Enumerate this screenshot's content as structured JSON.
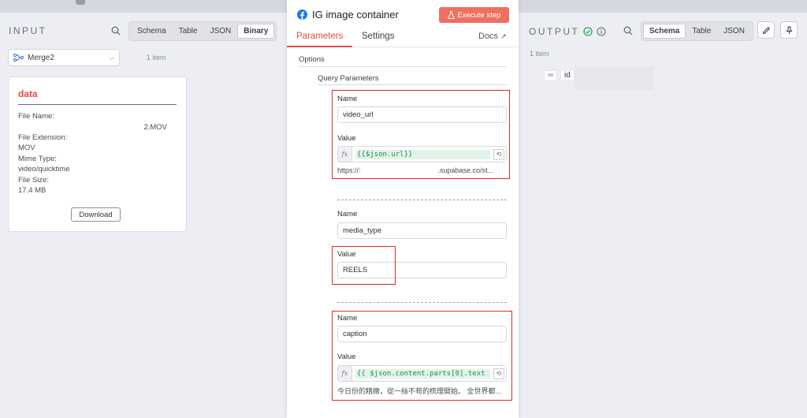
{
  "input": {
    "title": "INPUT",
    "tabs": [
      "Schema",
      "Table",
      "JSON",
      "Binary"
    ],
    "active_tab": "Binary",
    "node": "Merge2",
    "item_count": "1 item",
    "card": {
      "title": "data",
      "file_name_label": "File Name:",
      "file_name": "2.MOV",
      "file_ext_label": "File Extension:",
      "file_ext": "MOV",
      "mime_label": "Mime Type:",
      "mime": "video/quicktime",
      "size_label": "File Size:",
      "size": "17.4 MB",
      "download": "Download"
    }
  },
  "node_panel": {
    "title": "IG image container",
    "execute": "Execute step",
    "tabs": {
      "parameters": "Parameters",
      "settings": "Settings",
      "docs": "Docs"
    },
    "options": "Options",
    "query_params": "Query Parameters",
    "params": [
      {
        "name_label": "Name",
        "name": "video_url",
        "value_label": "Value",
        "value": "{{$json.url}}",
        "preview_start": "https://",
        "preview_end": ".supabase.co/st..."
      },
      {
        "name_label": "Name",
        "name": "media_type",
        "value_label": "Value",
        "value": "REELS"
      },
      {
        "name_label": "Name",
        "name": "caption",
        "value_label": "Value",
        "value": "{{ $json.content.parts[0].text }}",
        "preview": "今日份的精緻，從一絲不苟的梳理開始。 全世界都..."
      }
    ]
  },
  "output": {
    "title": "OUTPUT",
    "tabs": [
      "Schema",
      "Table",
      "JSON"
    ],
    "active_tab": "Schema",
    "item_count": "1 item",
    "field_type": "AB",
    "field_name": "id"
  },
  "colors": {
    "accent": "#ea4b40",
    "execute_bg": "#ef6f61",
    "highlight_box": "#e2272c",
    "expr_green": "#1e8b52",
    "success": "#2aa85a"
  }
}
